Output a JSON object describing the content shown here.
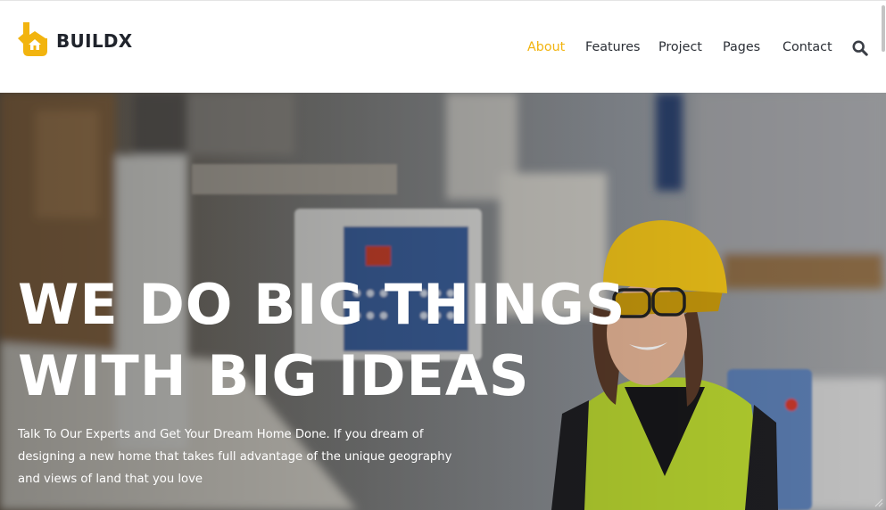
{
  "brand": {
    "name": "BUILDX",
    "accent": "#f2b40f",
    "text_color": "#20242c"
  },
  "nav": {
    "items": [
      {
        "label": "About",
        "active": true
      },
      {
        "label": "Features",
        "active": false
      },
      {
        "label": "Project",
        "active": false
      },
      {
        "label": "Pages",
        "active": false
      },
      {
        "label": "Contact",
        "active": false
      }
    ],
    "search_icon": "search-icon"
  },
  "hero": {
    "title_line_1": "WE DO BIG THINGS",
    "title_line_2": "WITH BIG IDEAS",
    "description": "Talk To Our Experts and Get Your Dream Home Done. If you dream of designing a new home that takes full advantage of the unique geography and views of land that you love",
    "background_image": "construction-worker-photo"
  }
}
